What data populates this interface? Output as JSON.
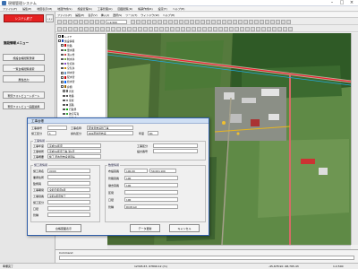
{
  "app": {
    "title": "現場管理システム"
  },
  "menubar": [
    "ファイル(F)",
    "編集(E)",
    "地図表示(M)",
    "地図作成(S)",
    "施設管理(K)",
    "工事管理(O)",
    "図面閲覧(D)",
    "帳票作成(R)",
    "設定(T)",
    "ヘルプ(H)"
  ],
  "left": {
    "red_button": "システム終了",
    "hdr_button": "システム管理メニュー",
    "section": "施設情報メニュー",
    "buttons": [
      "施設台帳閲覧登録",
      "一覧台帳閲覧検索",
      "属性出力",
      "現況フォトビューレポート",
      "現況フォトビュー画面連携"
    ]
  },
  "mapmenu": [
    "ファイル(F)",
    "編集(E)",
    "表示(V)",
    "挿入(I)",
    "選択(S)",
    "ツール(T)",
    "ウィンドウ(W)",
    "ヘルプ(H)"
  ],
  "toolbar": {
    "scale": "1:2,500"
  },
  "layers": [
    "レイヤ",
    "施設情報",
    "管路",
    "量水器",
    "消火栓",
    "制水弁",
    "仕切弁",
    "空気弁",
    "排水管",
    "配水管",
    "給水管",
    "弁類",
    "背景",
    "地番",
    "家屋",
    "道路",
    "行政界",
    "航空写真",
    "基準点"
  ],
  "layer_colors": [
    "#000",
    "#1f4fbd",
    "#c00",
    "#2d8a2d",
    "#d04747",
    "#7a4",
    "#84c",
    "#c80",
    "#69c",
    "#c00",
    "#06f",
    "#960",
    "#666",
    "#555",
    "#888",
    "#444",
    "#0a0",
    "#3a3",
    "#555"
  ],
  "dialog": {
    "title": "工事台帳",
    "top": {
      "l1": "工事番号",
      "v1": "",
      "l2": "工事名称",
      "v2": "配水管布設替工事",
      "l3": "施工区分",
      "v3": "1",
      "l4": "請負区分",
      "v4": "R01配水管布設",
      "l5": "年度",
      "v5": "R1"
    },
    "grp1_title": "工事情報",
    "grp1": [
      {
        "label": "工事年度",
        "value": "平成31年度"
      },
      {
        "label": "工事場所",
        "value": "平成31年度工事 第1号"
      },
      {
        "label": "工事概要",
        "value": "施工  配水管布設替延長"
      }
    ],
    "grp1r": [
      {
        "label": "工事区分",
        "value": ""
      },
      {
        "label": "設計番号",
        "value": ""
      }
    ],
    "grp2_title": "施工者情報",
    "grp2": [
      {
        "label": "施工者名",
        "value": "XXXX"
      },
      {
        "label": "業者住所",
        "value": ""
      },
      {
        "label": "監督員",
        "value": ""
      },
      {
        "label": "工事期間",
        "value": "令和元年度6月"
      },
      {
        "label": "工事延長",
        "value": "令和1年度施工"
      },
      {
        "label": "施工区分",
        "value": ""
      },
      {
        "label": "口径",
        "value": ""
      },
      {
        "label": "管種",
        "value": ""
      }
    ],
    "grp3_title": "数量情報",
    "grp3": [
      {
        "label": "布設延長",
        "value": "100.00",
        "value2": "50.00×100"
      },
      {
        "label": "管路延長",
        "value": "100"
      },
      {
        "label": "撤去延長",
        "value": "100"
      },
      {
        "label": "区間",
        "value": ""
      },
      {
        "label": "口径",
        "value": "100"
      },
      {
        "label": "管種",
        "value": "DCIP-GX"
      }
    ],
    "btn_left": "台帳図面表示",
    "btn_mid": "データ更新",
    "btn_right": "キャンセル"
  },
  "bottom": {
    "label": "Command"
  },
  "status": {
    "left": "準備完了",
    "mid": "12345.67, 67890.12  (m)",
    "right": "1:2,500",
    "coord": "-45,678.90  -98,765.43"
  }
}
